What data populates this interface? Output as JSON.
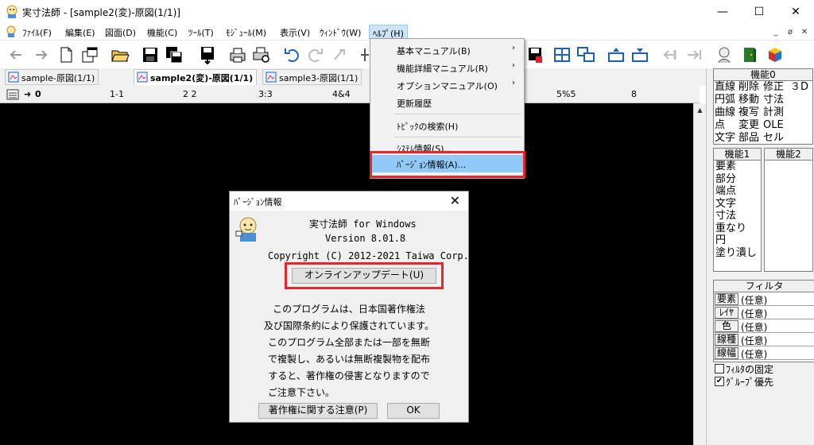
{
  "window": {
    "title": "実寸法師 - [sample2(変)-原図(1/1)]",
    "min_symbol": "—",
    "max_symbol": "☐",
    "close_symbol": "✕"
  },
  "menubar": {
    "items": [
      {
        "label": "ﾌｧｲﾙ(F)"
      },
      {
        "label": "編集(E)"
      },
      {
        "label": "図面(D)"
      },
      {
        "label": "機能(C)"
      },
      {
        "label": "ﾂｰﾙ(T)"
      },
      {
        "label": "ﾓｼﾞｭｰﾙ(M)"
      },
      {
        "label": "表示(V)"
      },
      {
        "label": "ｳｨﾝﾄﾞｳ(W)"
      },
      {
        "label": "ﾍﾙﾌﾟ(H)"
      }
    ],
    "mdi_min": "_",
    "mdi_restore": "ø",
    "mdi_close": "✕"
  },
  "tabs": [
    {
      "label": "sample-原図(1/1)"
    },
    {
      "label": "sample2(変)-原図(1/1)"
    },
    {
      "label": "sample3-原図(1/1)"
    }
  ],
  "layerbar": {
    "items": [
      "0",
      "1-1",
      "2 2",
      "3:3",
      "4&4",
      "5%5",
      "8"
    ]
  },
  "help_menu": {
    "items": [
      {
        "label": "基本マニュアル(B)",
        "arrow": "›"
      },
      {
        "label": "機能詳細マニュアル(R)",
        "arrow": "›"
      },
      {
        "label": "オプションマニュアル(O)",
        "arrow": "›"
      },
      {
        "label": "更新履歴"
      },
      {
        "label": "ﾄﾋﾟｯｸの検索(H)"
      },
      {
        "label": "ｼｽﾃﾑ情報(S)..."
      },
      {
        "label": "ﾊﾞｰｼﾞｮﾝ情報(A)..."
      }
    ]
  },
  "panel": {
    "kinou0": {
      "header": "機能0",
      "rows": [
        [
          "直線",
          "削除",
          "修正",
          "３D"
        ],
        [
          "円弧",
          "移動",
          "寸法",
          ""
        ],
        [
          "曲線",
          "複写",
          "計測",
          ""
        ],
        [
          "点",
          "変更",
          "OLE",
          ""
        ],
        [
          "文字",
          "部品",
          "セル",
          ""
        ]
      ]
    },
    "kinou1": {
      "header": "機能1",
      "items": [
        "要素",
        "部分",
        "端点",
        "文字",
        "寸法",
        "重なり",
        "円",
        "塗り潰し"
      ]
    },
    "kinou2": {
      "header": "機能2"
    },
    "filter": {
      "header": "フィルタ",
      "rows": [
        {
          "label": "要素",
          "value": "(任意)"
        },
        {
          "label": "ﾚｲﾔ",
          "value": "(任意)"
        },
        {
          "label": "色",
          "value": "(任意)"
        },
        {
          "label": "線種",
          "value": "(任意)"
        },
        {
          "label": "線幅",
          "value": "(任意)"
        }
      ],
      "fix_label": "ﾌｨﾙﾀの固定",
      "fix_checked": false,
      "group_label": "ｸﾞﾙｰﾌﾟ優先",
      "group_checked": true
    }
  },
  "dialog": {
    "title": "ﾊﾞｰｼﾞｮﾝ情報",
    "close": "✕",
    "product": "実寸法師 for Windows",
    "version": "Version 8.01.8",
    "copyright": "Copyright (C) 2012-2021 Taiwa Corp.",
    "online_update_button": "オンラインアップデート(U)",
    "notice": [
      "このプログラムは、日本国著作権法",
      "及び国際条約により保護されています。",
      "このプログラム全部または一部を無断",
      "で複製し、あるいは無断複製物を配布",
      "すると、著作権の侵害となりますので",
      "ご注意下さい。"
    ],
    "copyright_notice_button": "著作権に関する注意(P)",
    "ok_button": "OK"
  },
  "colors": {
    "highlight_red": "#e8262a",
    "menu_hover": "#91c9f7",
    "canvas": "#000000"
  }
}
